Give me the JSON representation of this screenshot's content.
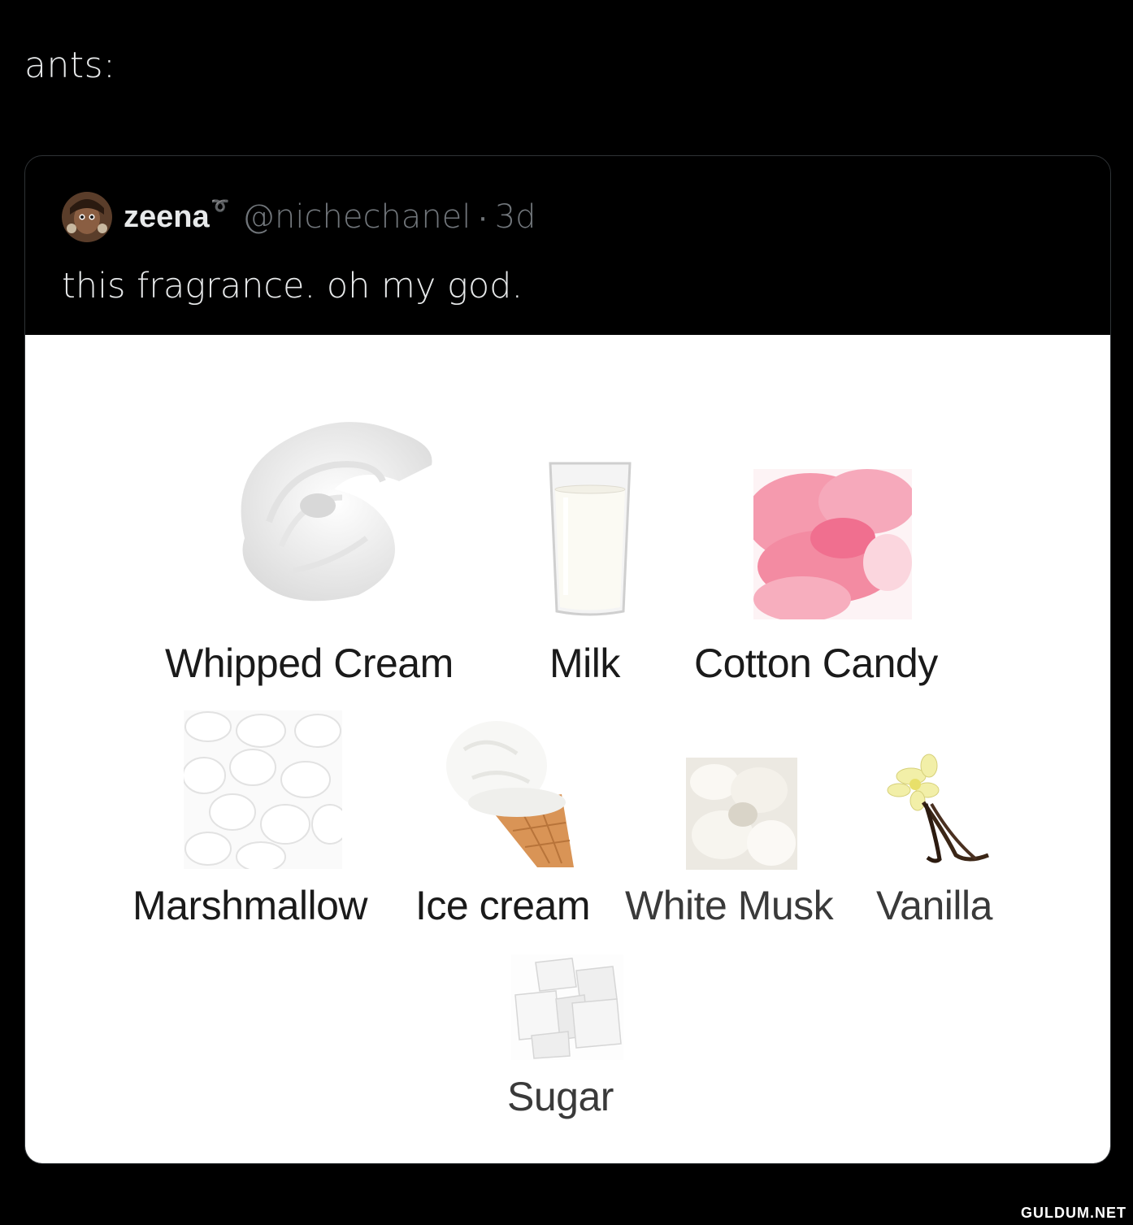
{
  "tweet": {
    "text": "ants:"
  },
  "quote": {
    "author_name": "zeena",
    "author_badge": "➰",
    "handle": "@nichechanel",
    "separator": "·",
    "time": "3d",
    "text": "this fragrance. oh my god."
  },
  "notes": [
    {
      "label": "Whipped Cream",
      "icon": "whipped-cream-image"
    },
    {
      "label": "Milk",
      "icon": "milk-glass-image"
    },
    {
      "label": "Cotton Candy",
      "icon": "cotton-candy-image"
    },
    {
      "label": "Marshmallow",
      "icon": "marshmallow-image"
    },
    {
      "label": "Ice cream",
      "icon": "ice-cream-cone-image"
    },
    {
      "label": "White Musk",
      "icon": "white-musk-image"
    },
    {
      "label": "Vanilla",
      "icon": "vanilla-flower-image"
    },
    {
      "label": "Sugar",
      "icon": "sugar-cubes-image"
    }
  ],
  "watermark": "GULDUM.NET"
}
